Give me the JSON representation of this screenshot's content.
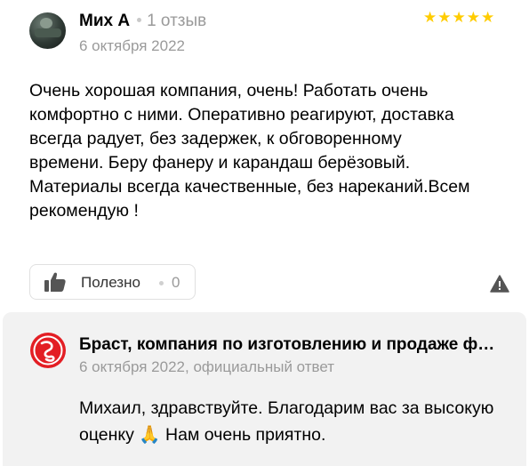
{
  "review": {
    "author_name": "Мих А",
    "author_reviews": "1 отзыв",
    "date": "6 октября 2022",
    "rating": 5,
    "text": "Очень хорошая компания, очень! Работать очень комфортно с ними. Оперативно реагируют, доставка всегда радует, без задержек, к обговоренному времени. Беру фанеру и карандаш берёзовый. Материалы всегда качественные, без нареканий.Всем рекомендую !",
    "useful_label": "Полезно",
    "useful_count": "0"
  },
  "answer": {
    "org_name": "Браст, компания по изготовлению и продаже фанеры",
    "meta": "6 октября 2022, официальный ответ",
    "text": "Михаил, здравствуйте. Благодарим вас за высокую оценку 🙏 Нам очень приятно."
  },
  "colors": {
    "star": "#ffcc00",
    "muted": "#9a9a9a",
    "answer_bg": "#f2f2f2",
    "logo_red": "#e31e24"
  }
}
